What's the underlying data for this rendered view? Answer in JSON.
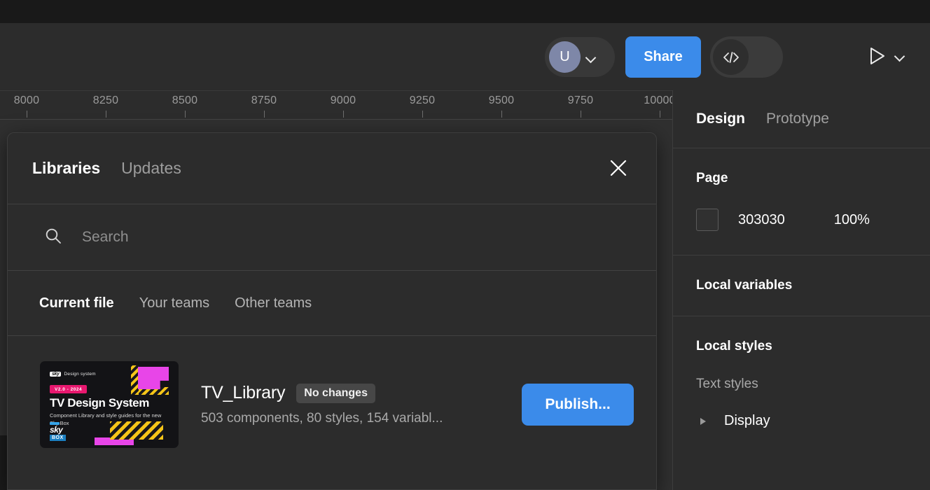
{
  "toolbar": {
    "avatar_initial": "U",
    "avatar_caret_icon": "chevron-down-icon",
    "share_label": "Share",
    "dev_mode_icon": "code-brackets-icon",
    "library_icon": "open-book-icon",
    "library_has_notification": true,
    "present_icon": "play-triangle-icon",
    "present_caret_icon": "chevron-down-icon",
    "accent_blue": "#3b8bea"
  },
  "ruler": {
    "ticks": [
      "8000",
      "8250",
      "8500",
      "8750",
      "9000",
      "9250",
      "9500",
      "9750",
      "10000"
    ]
  },
  "modal": {
    "tabs": [
      {
        "label": "Libraries",
        "active": true
      },
      {
        "label": "Updates",
        "active": false
      }
    ],
    "close_icon": "close-x-icon",
    "search": {
      "icon": "search-icon",
      "placeholder": "Search",
      "value": ""
    },
    "filters": [
      {
        "label": "Current file",
        "active": true
      },
      {
        "label": "Your teams",
        "active": false
      },
      {
        "label": "Other teams",
        "active": false
      }
    ],
    "library": {
      "name": "TV_Library",
      "status_badge": "No changes",
      "description": "503 components, 80 styles, 154 variabl...",
      "publish_label": "Publish...",
      "thumbnail": {
        "brand": "sky",
        "brand_suffix": "Design system",
        "version_badge": "V2.0 - 2024",
        "title": "TV Design System",
        "subtitle": "Component Library and style guides for the new Sky Box",
        "footer_brand": "sky",
        "footer_brand_sub": "BOX",
        "colors": {
          "background": "#131316",
          "magenta": "#e845e8",
          "yellow": "#f5c518",
          "pink_badge": "#e8186f",
          "blue": "#1a7fc1"
        }
      }
    }
  },
  "sidebar": {
    "tabs": [
      {
        "label": "Design",
        "active": true
      },
      {
        "label": "Prototype",
        "active": false
      }
    ],
    "page": {
      "label": "Page",
      "swatch_color": "#303030",
      "hex": "303030",
      "opacity": "100%"
    },
    "local_variables": {
      "label": "Local variables"
    },
    "local_styles": {
      "label": "Local styles",
      "text_styles_label": "Text styles",
      "items": [
        {
          "label": "Display",
          "caret_icon": "caret-right-icon",
          "expanded": false
        }
      ]
    }
  }
}
